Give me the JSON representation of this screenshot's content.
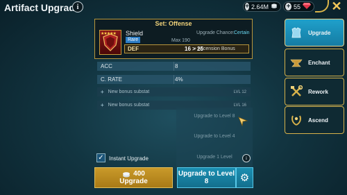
{
  "header": {
    "title": "Artifact Upgrade",
    "info_glyph": "i",
    "silver_amount": "2.64M",
    "gems_amount": "55",
    "close_glyph": "✕"
  },
  "artifact": {
    "set_title": "Set: Offense",
    "name": "Shield",
    "rarity": "Rare",
    "stars": "★★★★★",
    "upgrade_chance_label": "Upgrade Chance:",
    "upgrade_chance_value": "Certain",
    "max_label": "Max 190",
    "main_stat": {
      "name": "DEF",
      "value": "16 > 25",
      "ascension_label": "+ Ascension Bonus"
    }
  },
  "substats": [
    {
      "name": "ACC",
      "value": "8",
      "level": ""
    },
    {
      "name": "C. RATE",
      "value": "4%",
      "level": ""
    },
    {
      "name": "New bonus substat",
      "value": "",
      "level": "LVL 12"
    },
    {
      "name": "New bonus substat",
      "value": "",
      "level": "LVL 16"
    }
  ],
  "dropdown": {
    "items": [
      "Upgrade to Level 8",
      "Upgrade to Level 4",
      "Upgrade 1 Level"
    ],
    "info_glyph": "i"
  },
  "instant_upgrade": {
    "label": "Instant Upgrade",
    "checked": true,
    "check_glyph": "✓"
  },
  "buttons": {
    "upgrade_cost": "400",
    "upgrade_label": "Upgrade",
    "level_line1": "Upgrade to Level",
    "level_line2": "8",
    "gear_glyph": "⚙"
  },
  "tabs": [
    {
      "label": "Upgrade",
      "active": true,
      "icon": "armor-icon"
    },
    {
      "label": "Enchant",
      "active": false,
      "icon": "anvil-icon"
    },
    {
      "label": "Rework",
      "active": false,
      "icon": "hammer-wrench-icon"
    },
    {
      "label": "Ascend",
      "active": false,
      "icon": "laurel-icon"
    }
  ],
  "colors": {
    "accent_gold": "#d8b24a",
    "accent_blue": "#1fa0cb",
    "chance_text": "#69d7f0"
  }
}
